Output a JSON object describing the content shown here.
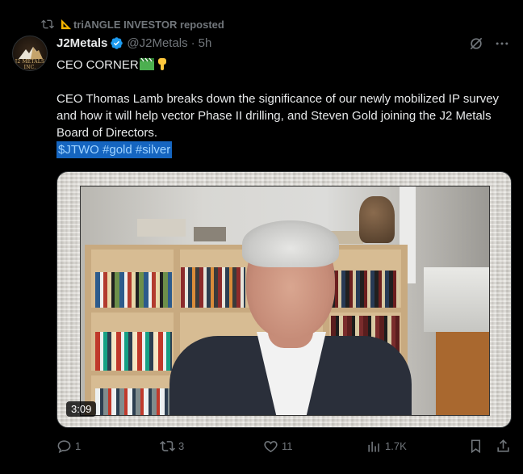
{
  "repost": {
    "label": "triANGLE INVESTOR reposted"
  },
  "author": {
    "avatar_text": "J2 METALS INC.",
    "name": "J2Metals",
    "handle": "@J2Metals",
    "separator": "·",
    "time": "5h"
  },
  "post": {
    "line1": "CEO CORNER",
    "line2": "CEO Thomas Lamb breaks down the significance of our newly mobilized IP survey and how it will help vector Phase II drilling, and Steven Gold joining the J2 Metals Board of Directors.",
    "tags": [
      "$JTWO",
      "#gold",
      "#silver"
    ]
  },
  "media": {
    "duration": "3:09"
  },
  "actions": {
    "replies": "1",
    "reposts": "3",
    "likes": "11",
    "views": "1.7K"
  },
  "colors": {
    "background": "#000000",
    "text": "#e7e9ea",
    "muted": "#71767b",
    "verified": "#1d9bf0",
    "hashtag_bg": "#1565c0"
  }
}
